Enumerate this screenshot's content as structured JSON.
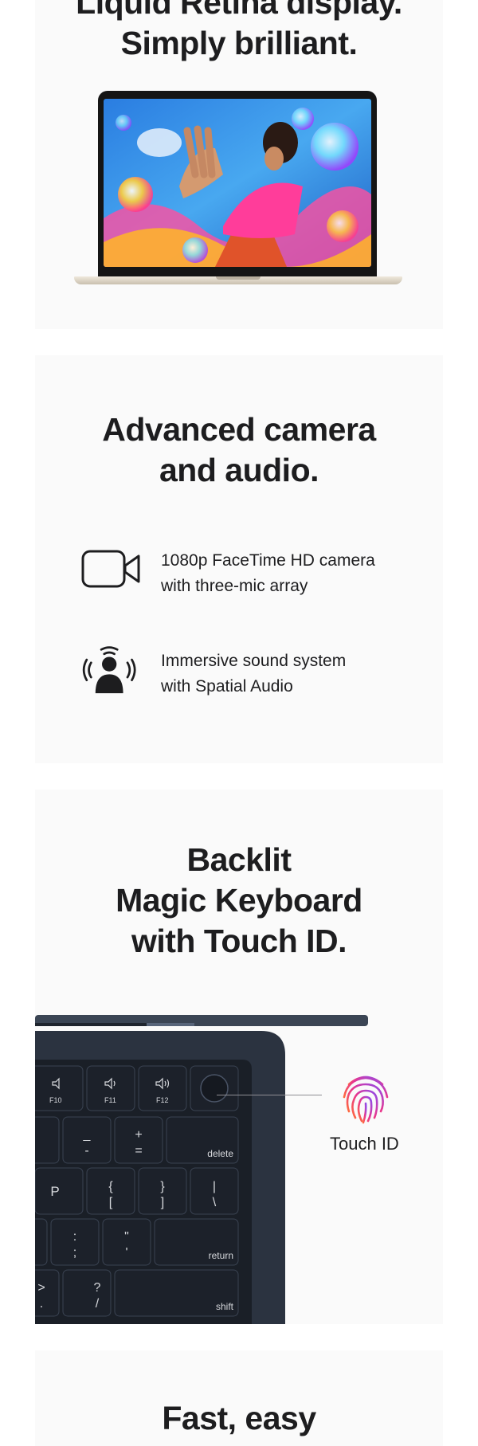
{
  "display_section": {
    "headline_line1": "Liquid Retina display.",
    "headline_line2": "Simply brilliant."
  },
  "camera_section": {
    "headline_line1": "Advanced camera",
    "headline_line2": "and audio.",
    "features": [
      {
        "icon": "video-camera-icon",
        "line1": "1080p FaceTime HD camera",
        "line2": "with three-mic array"
      },
      {
        "icon": "spatial-audio-icon",
        "line1": "Immersive sound system",
        "line2": "with Spatial Audio"
      }
    ]
  },
  "keyboard_section": {
    "headline_line1": "Backlit",
    "headline_line2": "Magic Keyboard",
    "headline_line3": "with Touch ID.",
    "keys": {
      "f10": "F10",
      "f11": "F11",
      "f12": "F12",
      "minus_top": "_",
      "minus_bottom": "-",
      "plus_top": "+",
      "plus_bottom": "=",
      "delete": "delete",
      "p": "P",
      "brace_open_top": "{",
      "brace_open_bottom": "[",
      "brace_close_top": "}",
      "brace_close_bottom": "]",
      "pipe_top": "|",
      "pipe_bottom": "\\",
      "colon_top": ":",
      "colon_bottom": ";",
      "quote_top": "\"",
      "quote_bottom": "'",
      "return": "return",
      "gt_top": ">",
      "gt_bottom": ".",
      "question_top": "?",
      "question_bottom": "/",
      "shift": "shift"
    },
    "touch_id_label": "Touch ID",
    "colors": {
      "keyboard_body": "#2b3340",
      "key": "#1c212a",
      "key_text": "#d6d8dc",
      "touch_id_gradient": [
        "#ff6a3d",
        "#e8368f",
        "#8a4cf0"
      ]
    }
  },
  "next_section": {
    "headline": "Fast, easy"
  },
  "colors": {
    "card_background": "#fafafa",
    "headline": "#1d1d1f"
  }
}
